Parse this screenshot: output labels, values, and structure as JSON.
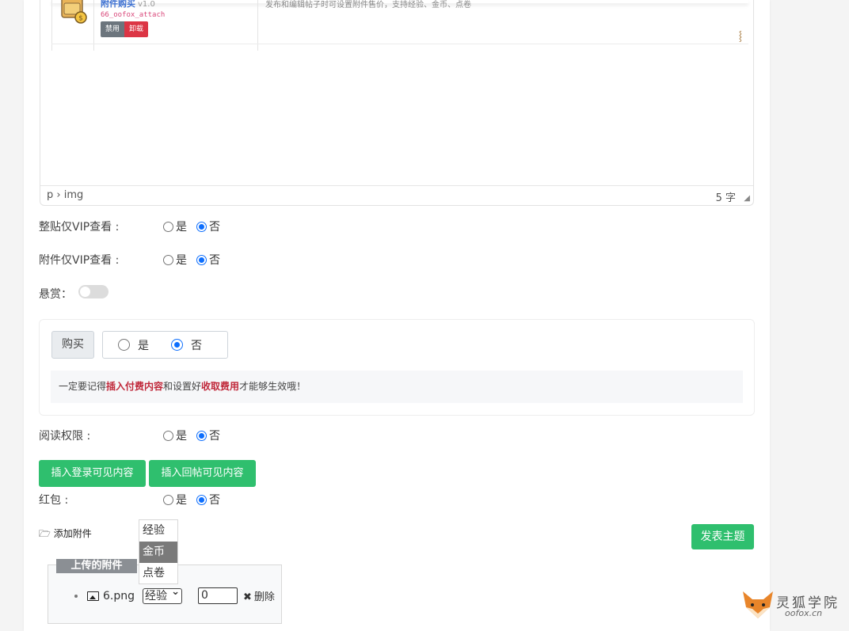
{
  "plugin": {
    "name": "附件购买",
    "version": "v1.0",
    "id": "66_oofox_attach",
    "disable_label": "禁用",
    "unload_label": "卸载",
    "description": "发布和编辑帖子时可设置附件售价，支持经验、金币、点卷"
  },
  "editor": {
    "path": "p › img",
    "wordcount": "5 字"
  },
  "vip_post": {
    "label": "整贴仅VIP查看 :",
    "yes": "是",
    "no": "否",
    "selected": "no"
  },
  "vip_attach": {
    "label": "附件仅VIP查看 :",
    "yes": "是",
    "no": "否",
    "selected": "no"
  },
  "reward": {
    "label": "悬赏：",
    "enabled": false
  },
  "buy": {
    "label": "购买",
    "yes": "是",
    "no": "否",
    "selected": "no",
    "notice_pre": "一定要记得",
    "notice_b1": "插入付费内容",
    "notice_mid": "和设置好",
    "notice_b2": "收取费用",
    "notice_post": "才能够生效哦！"
  },
  "read_perm": {
    "label": "阅读权限 :",
    "yes": "是",
    "no": "否",
    "selected": "no"
  },
  "buttons": {
    "insert_login": "插入登录可见内容",
    "insert_reply": "插入回帖可见内容",
    "publish": "发表主题"
  },
  "red_packet": {
    "label": "红包 :",
    "yes": "是",
    "no": "否",
    "selected": "no"
  },
  "attachments": {
    "add_label": "添加附件",
    "dropdown_options": [
      "经验",
      "金币",
      "点卷"
    ],
    "dropdown_selected": "金币",
    "uploaded_title": "上传的附件",
    "files": [
      {
        "name": "6.png",
        "currency": "经验",
        "price": "0",
        "delete_label": "删除"
      }
    ]
  },
  "logo": {
    "text": "灵狐学院",
    "sub": "oofox.cn"
  },
  "colors": {
    "green": "#2fbf6e",
    "red": "#dc3545",
    "blue": "#0d6efd"
  }
}
